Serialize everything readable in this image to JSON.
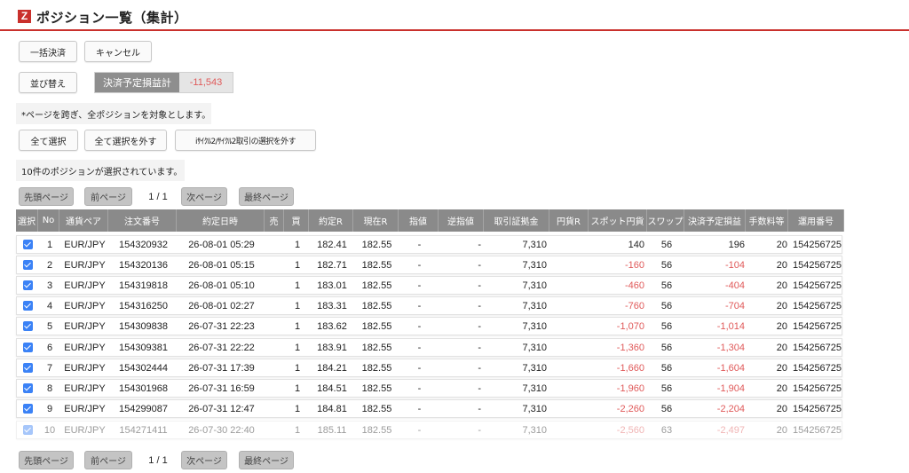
{
  "header": {
    "logo": "Z",
    "title": "ポジション一覧（集計）"
  },
  "actions": {
    "bulk_settle": "一括決済",
    "cancel": "キャンセル",
    "sort": "並び替え",
    "pl_label": "決済予定損益計",
    "pl_value": "-11,543"
  },
  "notice": "*ページを跨ぎ、全ポジションを対象とします。",
  "selection": {
    "select_all": "全て選択",
    "deselect_all": "全て選択を外す",
    "deselect_cycle": "iｻｲｸﾙ2/ｻｲｸﾙ2取引の選択を外す",
    "status": "10件のポジションが選択されています。"
  },
  "pager": {
    "first": "先頭ページ",
    "prev": "前ページ",
    "info": "1 / 1",
    "next": "次ページ",
    "last": "最終ページ"
  },
  "table": {
    "columns": [
      "選択",
      "No",
      "通貨ペア",
      "注文番号",
      "約定日時",
      "売",
      "買",
      "約定R",
      "現在R",
      "指値",
      "逆指値",
      "取引証拠金",
      "円貨R",
      "スポット円貨",
      "スワップ",
      "決済予定損益",
      "手数料等",
      "運用番号"
    ],
    "rows": [
      {
        "no": "1",
        "pair": "EUR/JPY",
        "order": "154320932",
        "datetime": "26-08-01 05:29",
        "sell": "",
        "buy": "1",
        "rate": "182.41",
        "current": "182.55",
        "limit": "-",
        "stop": "-",
        "margin": "7,310",
        "yen": "",
        "spot": "140",
        "swap": "56",
        "pl": "196",
        "fee": "20",
        "mgmt": "154256725"
      },
      {
        "no": "2",
        "pair": "EUR/JPY",
        "order": "154320136",
        "datetime": "26-08-01 05:15",
        "sell": "",
        "buy": "1",
        "rate": "182.71",
        "current": "182.55",
        "limit": "-",
        "stop": "-",
        "margin": "7,310",
        "yen": "",
        "spot": "-160",
        "swap": "56",
        "pl": "-104",
        "fee": "20",
        "mgmt": "154256725"
      },
      {
        "no": "3",
        "pair": "EUR/JPY",
        "order": "154319818",
        "datetime": "26-08-01 05:10",
        "sell": "",
        "buy": "1",
        "rate": "183.01",
        "current": "182.55",
        "limit": "-",
        "stop": "-",
        "margin": "7,310",
        "yen": "",
        "spot": "-460",
        "swap": "56",
        "pl": "-404",
        "fee": "20",
        "mgmt": "154256725"
      },
      {
        "no": "4",
        "pair": "EUR/JPY",
        "order": "154316250",
        "datetime": "26-08-01 02:27",
        "sell": "",
        "buy": "1",
        "rate": "183.31",
        "current": "182.55",
        "limit": "-",
        "stop": "-",
        "margin": "7,310",
        "yen": "",
        "spot": "-760",
        "swap": "56",
        "pl": "-704",
        "fee": "20",
        "mgmt": "154256725"
      },
      {
        "no": "5",
        "pair": "EUR/JPY",
        "order": "154309838",
        "datetime": "26-07-31 22:23",
        "sell": "",
        "buy": "1",
        "rate": "183.62",
        "current": "182.55",
        "limit": "-",
        "stop": "-",
        "margin": "7,310",
        "yen": "",
        "spot": "-1,070",
        "swap": "56",
        "pl": "-1,014",
        "fee": "20",
        "mgmt": "154256725"
      },
      {
        "no": "6",
        "pair": "EUR/JPY",
        "order": "154309381",
        "datetime": "26-07-31 22:22",
        "sell": "",
        "buy": "1",
        "rate": "183.91",
        "current": "182.55",
        "limit": "-",
        "stop": "-",
        "margin": "7,310",
        "yen": "",
        "spot": "-1,360",
        "swap": "56",
        "pl": "-1,304",
        "fee": "20",
        "mgmt": "154256725"
      },
      {
        "no": "7",
        "pair": "EUR/JPY",
        "order": "154302444",
        "datetime": "26-07-31 17:39",
        "sell": "",
        "buy": "1",
        "rate": "184.21",
        "current": "182.55",
        "limit": "-",
        "stop": "-",
        "margin": "7,310",
        "yen": "",
        "spot": "-1,660",
        "swap": "56",
        "pl": "-1,604",
        "fee": "20",
        "mgmt": "154256725"
      },
      {
        "no": "8",
        "pair": "EUR/JPY",
        "order": "154301968",
        "datetime": "26-07-31 16:59",
        "sell": "",
        "buy": "1",
        "rate": "184.51",
        "current": "182.55",
        "limit": "-",
        "stop": "-",
        "margin": "7,310",
        "yen": "",
        "spot": "-1,960",
        "swap": "56",
        "pl": "-1,904",
        "fee": "20",
        "mgmt": "154256725"
      },
      {
        "no": "9",
        "pair": "EUR/JPY",
        "order": "154299087",
        "datetime": "26-07-31 12:47",
        "sell": "",
        "buy": "1",
        "rate": "184.81",
        "current": "182.55",
        "limit": "-",
        "stop": "-",
        "margin": "7,310",
        "yen": "",
        "spot": "-2,260",
        "swap": "56",
        "pl": "-2,204",
        "fee": "20",
        "mgmt": "154256725"
      },
      {
        "no": "10",
        "pair": "EUR/JPY",
        "order": "154271411",
        "datetime": "26-07-30 22:40",
        "sell": "",
        "buy": "1",
        "rate": "185.11",
        "current": "182.55",
        "limit": "-",
        "stop": "-",
        "margin": "7,310",
        "yen": "",
        "spot": "-2,560",
        "swap": "63",
        "pl": "-2,497",
        "fee": "20",
        "mgmt": "154256725"
      }
    ]
  },
  "colors": {
    "accent": "#c9302c",
    "negative": "#e05a5a",
    "header_bg": "#8a8a8a",
    "checkbox": "#3b82f6"
  }
}
